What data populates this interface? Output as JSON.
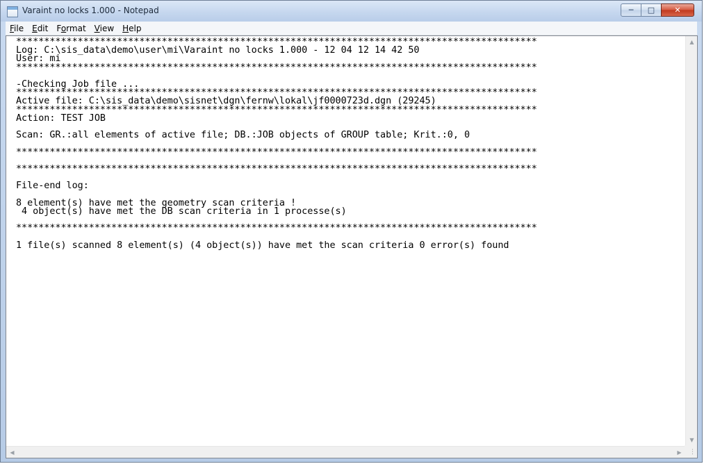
{
  "window": {
    "title": "Varaint no locks 1.000 - Notepad",
    "icon": "notepad-icon",
    "controls": {
      "minimize": "minimize-icon",
      "maximize": "maximize-icon",
      "close": "close-icon"
    }
  },
  "menu": [
    {
      "key": "F",
      "rest": "ile"
    },
    {
      "key": "E",
      "rest": "dit"
    },
    {
      "pre": "F",
      "key": "o",
      "rest": "rmat"
    },
    {
      "key": "V",
      "rest": "iew"
    },
    {
      "key": "H",
      "rest": "elp"
    }
  ],
  "document": {
    "lines": [
      "*********************************************************************************************",
      "Log: C:\\sis_data\\demo\\user\\mi\\Varaint no locks 1.000 - 12 04 12 14 42 50",
      "User: mi",
      "*********************************************************************************************",
      "",
      "-Checking Job file ...",
      "*********************************************************************************************",
      "Active file: C:\\sis_data\\demo\\sisnet\\dgn\\fernw\\lokal\\jf0000723d.dgn (29245)",
      "*********************************************************************************************",
      "Action: TEST JOB",
      "",
      "Scan: GR.:all elements of active file; DB.:JOB objects of GROUP table; Krit.:0, 0",
      "",
      "*********************************************************************************************",
      "",
      "*********************************************************************************************",
      "",
      "File-end log:",
      "",
      "8 element(s) have met the geometry scan criteria !",
      " 4 object(s) have met the DB scan criteria in 1 processe(s)",
      "",
      "*********************************************************************************************",
      "",
      "1 file(s) scanned 8 element(s) (4 object(s)) have met the scan criteria 0 error(s) found"
    ]
  },
  "scrollbars": {
    "up": "scroll-up-icon",
    "down": "scroll-down-icon",
    "left": "scroll-left-icon",
    "right": "scroll-right-icon"
  }
}
